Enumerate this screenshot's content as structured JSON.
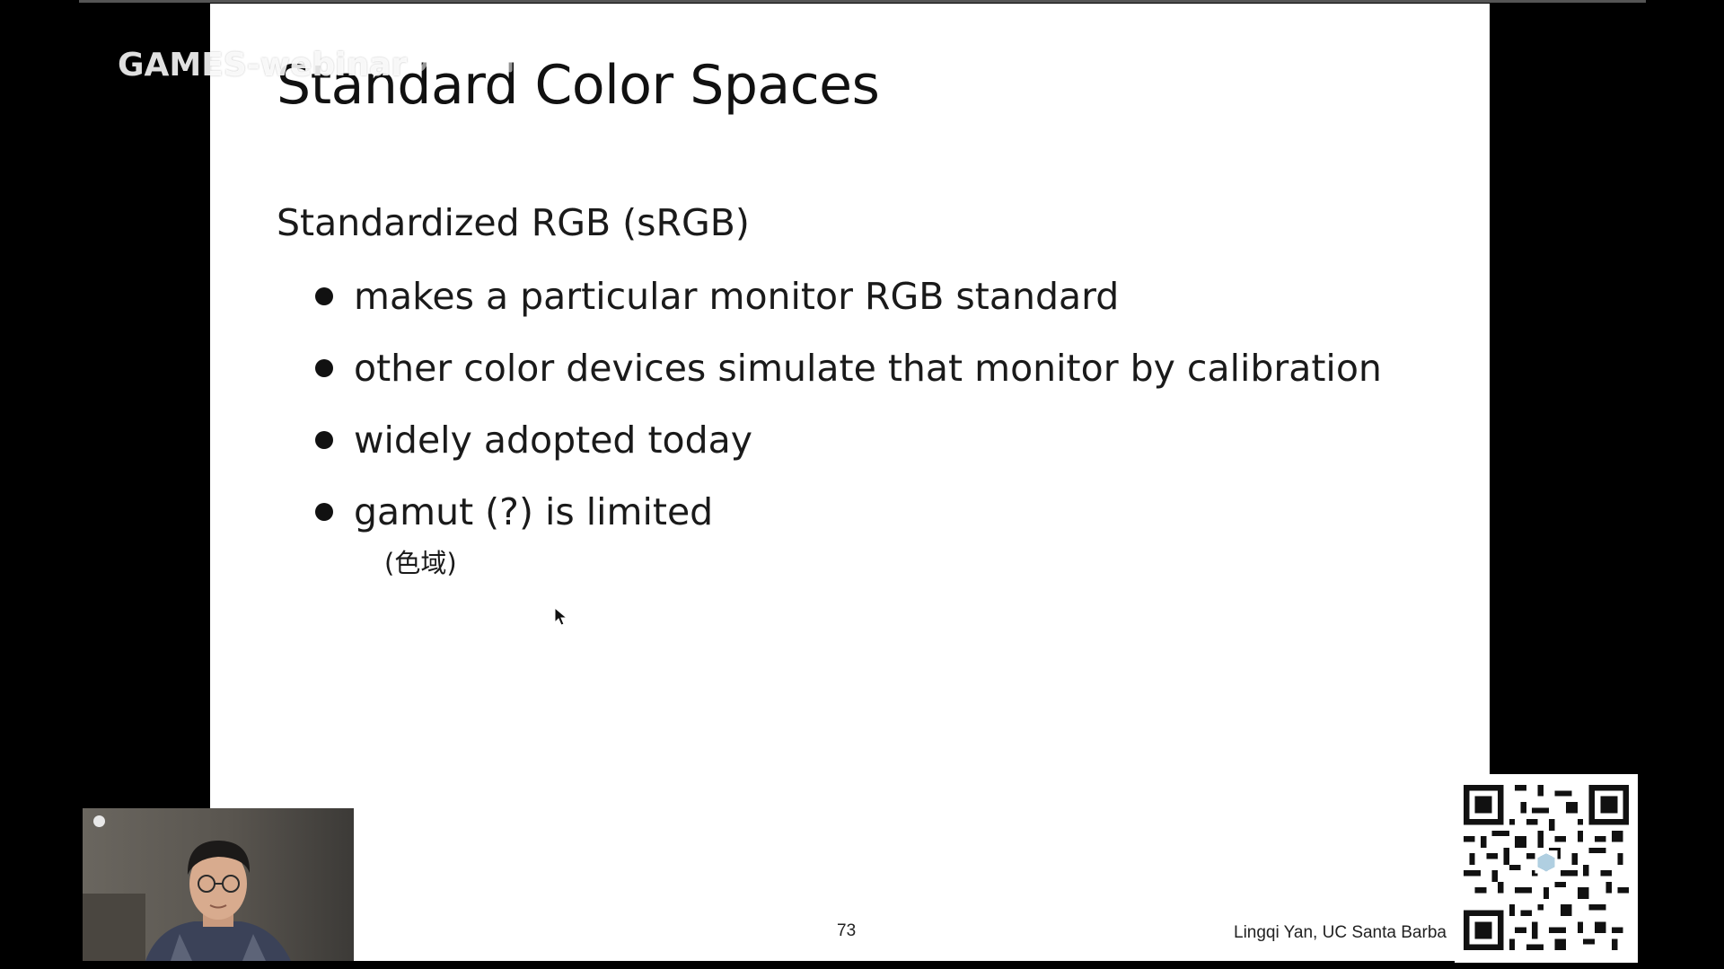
{
  "overlay": {
    "channel_watermark": "GAMES-webinar",
    "site_logo_icon": "bilibili-logo-icon"
  },
  "slide": {
    "title": "Standard Color Spaces",
    "subtitle": "Standardized RGB (sRGB)",
    "bullets": [
      "makes a particular monitor RGB standard",
      "other color devices simulate that monitor by calibration",
      "widely adopted today",
      "gamut (?) is limited"
    ],
    "gamut_note": "(色域)",
    "page_number": "73",
    "author": "Lingqi Yan, UC Santa Barba"
  },
  "webcam": {
    "description_icon": "presenter-video-feed"
  },
  "qr": {
    "icon": "qr-code-icon"
  },
  "colors": {
    "background": "#000000",
    "slide_background": "#ffffff",
    "text": "#1a1a1a"
  }
}
